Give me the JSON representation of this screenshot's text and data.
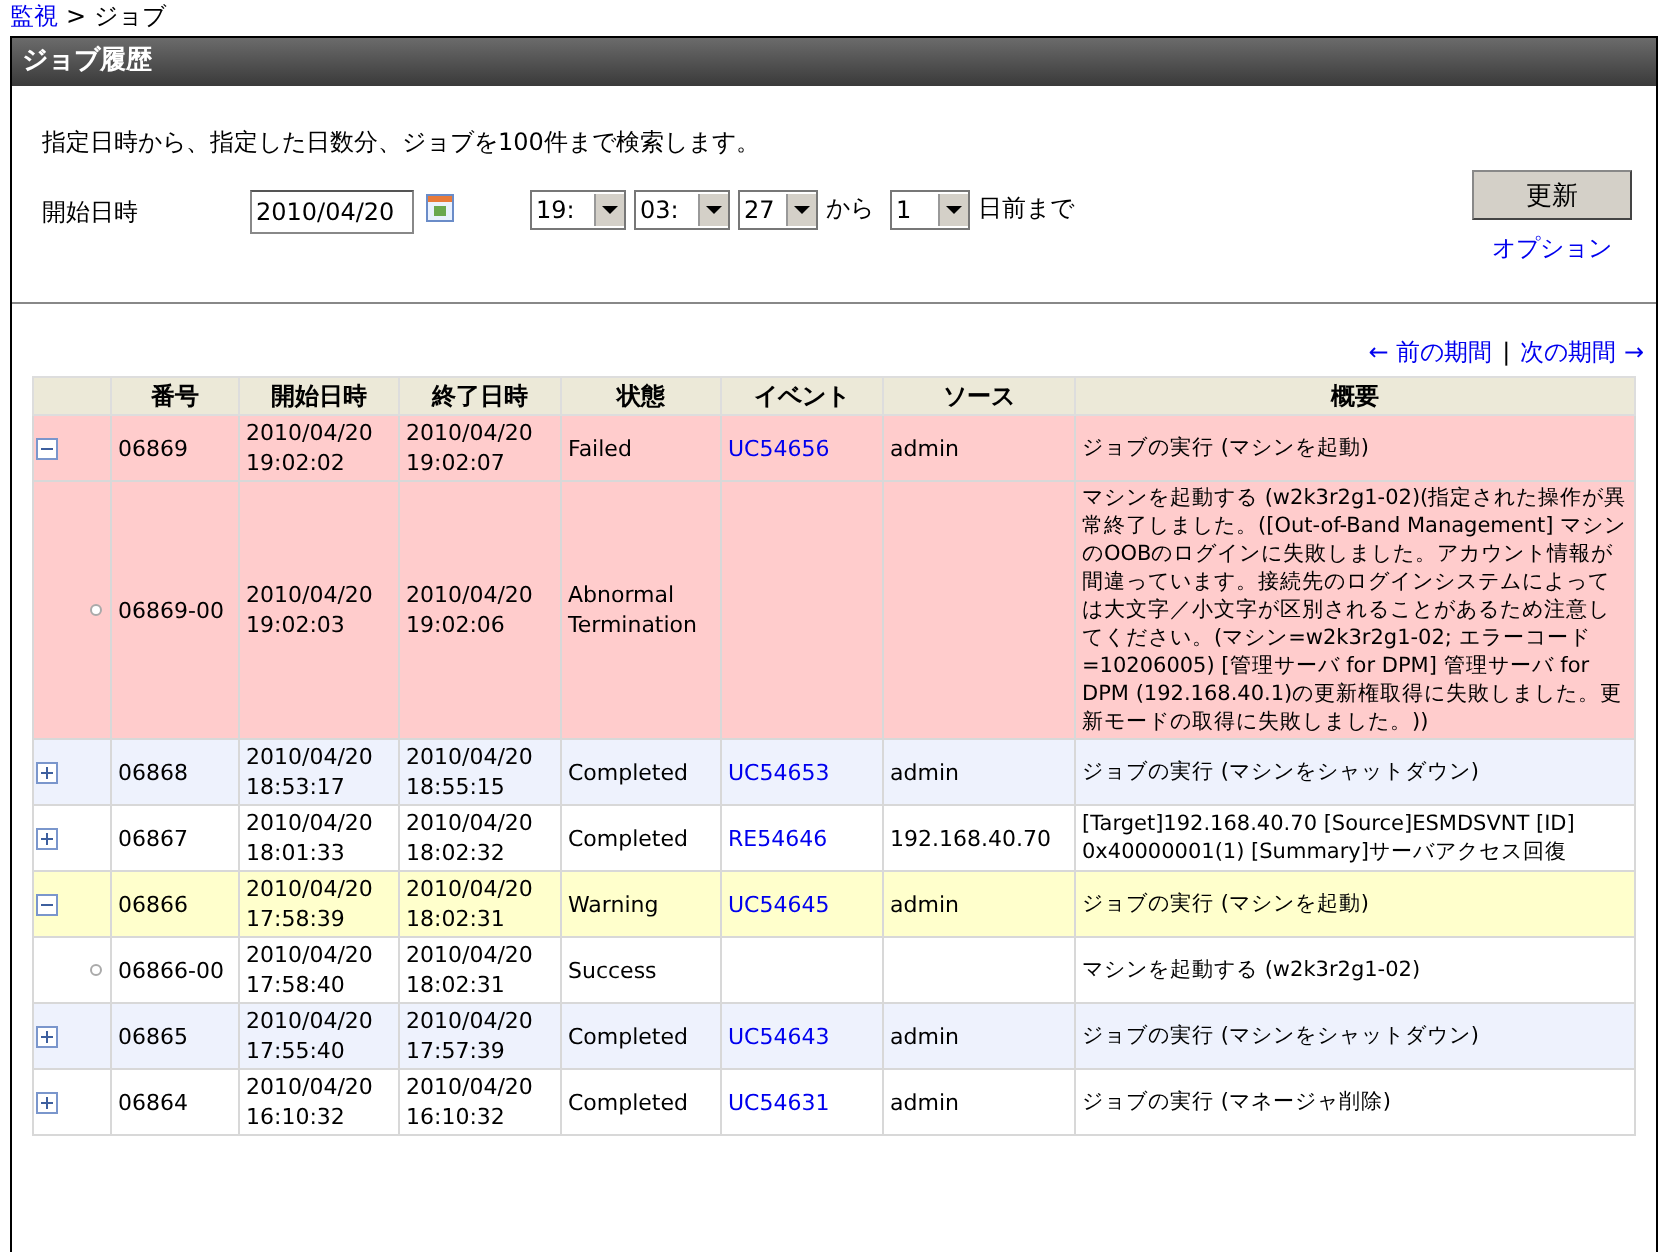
{
  "breadcrumb": {
    "link": "監視",
    "separator": ">",
    "current": "ジョブ"
  },
  "panel": {
    "title": "ジョブ履歴"
  },
  "search": {
    "description": "指定日時から、指定した日数分、ジョブを100件まで検索します。",
    "label": "開始日時",
    "date": "2010/04/20",
    "hour": "19:",
    "minute": "03:",
    "second": "27",
    "from_text": "から",
    "days": "1",
    "until_text": "日前まで",
    "update_button": "更新",
    "options_link": "オプション"
  },
  "pagination": {
    "previous": "← 前の期間",
    "separator": "|",
    "next": "次の期間 →"
  },
  "table": {
    "columns": [
      "",
      "番号",
      "開始日時",
      "終了日時",
      "状態",
      "イベント",
      "ソース",
      "概要"
    ],
    "rows": [
      {
        "kind": "parent",
        "expanded": true,
        "color": "#ffcccc",
        "number": "06869",
        "start": [
          "2010/04/20",
          "19:02:02"
        ],
        "end": [
          "2010/04/20",
          "19:02:07"
        ],
        "status": "Failed",
        "event": "UC54656",
        "source": "admin",
        "summary": "ジョブの実行 (マシンを起動)"
      },
      {
        "kind": "child",
        "color": "#ffcccc",
        "number": "06869-00",
        "start": [
          "2010/04/20",
          "19:02:03"
        ],
        "end": [
          "2010/04/20",
          "19:02:06"
        ],
        "status": "Abnormal Termination",
        "event": "",
        "source": "",
        "summary": "マシンを起動する (w2k3r2g1-02)(指定された操作が異常終了しました。([Out-of-Band Management] マシンのOOBのログインに失敗しました。アカウント情報が間違っています。接続先のログインシステムによっては大文字／小文字が区別されることがあるため注意してください。(マシン=w2k3r2g1-02; エラーコード=10206005) [管理サーバ for DPM] 管理サーバ for DPM (192.168.40.1)の更新権取得に失敗しました。更新モードの取得に失敗しました。))"
      },
      {
        "kind": "parent",
        "expanded": false,
        "color": "#eef2fd",
        "number": "06868",
        "start": [
          "2010/04/20",
          "18:53:17"
        ],
        "end": [
          "2010/04/20",
          "18:55:15"
        ],
        "status": "Completed",
        "event": "UC54653",
        "source": "admin",
        "summary": "ジョブの実行 (マシンをシャットダウン)"
      },
      {
        "kind": "parent",
        "expanded": false,
        "color": "#ffffff",
        "number": "06867",
        "start": [
          "2010/04/20",
          "18:01:33"
        ],
        "end": [
          "2010/04/20",
          "18:02:32"
        ],
        "status": "Completed",
        "event": "RE54646",
        "source": "192.168.40.70",
        "summary": "[Target]192.168.40.70 [Source]ESMDSVNT [ID] 0x40000001(1) [Summary]サーバアクセス回復"
      },
      {
        "kind": "parent",
        "expanded": true,
        "color": "#ffffcc",
        "number": "06866",
        "start": [
          "2010/04/20",
          "17:58:39"
        ],
        "end": [
          "2010/04/20",
          "18:02:31"
        ],
        "status": "Warning",
        "event": "UC54645",
        "source": "admin",
        "summary": "ジョブの実行 (マシンを起動)"
      },
      {
        "kind": "child",
        "color": "#ffffff",
        "number": "06866-00",
        "start": [
          "2010/04/20",
          "17:58:40"
        ],
        "end": [
          "2010/04/20",
          "18:02:31"
        ],
        "status": "Success",
        "event": "",
        "source": "",
        "summary": "マシンを起動する (w2k3r2g1-02)"
      },
      {
        "kind": "parent",
        "expanded": false,
        "color": "#eef2fd",
        "number": "06865",
        "start": [
          "2010/04/20",
          "17:55:40"
        ],
        "end": [
          "2010/04/20",
          "17:57:39"
        ],
        "status": "Completed",
        "event": "UC54643",
        "source": "admin",
        "summary": "ジョブの実行 (マシンをシャットダウン)"
      },
      {
        "kind": "parent",
        "expanded": false,
        "color": "#ffffff",
        "number": "06864",
        "start": [
          "2010/04/20",
          "16:10:32"
        ],
        "end": [
          "2010/04/20",
          "16:10:32"
        ],
        "status": "Completed",
        "event": "UC54631",
        "source": "admin",
        "summary": "ジョブの実行 (マネージャ削除)"
      }
    ]
  }
}
